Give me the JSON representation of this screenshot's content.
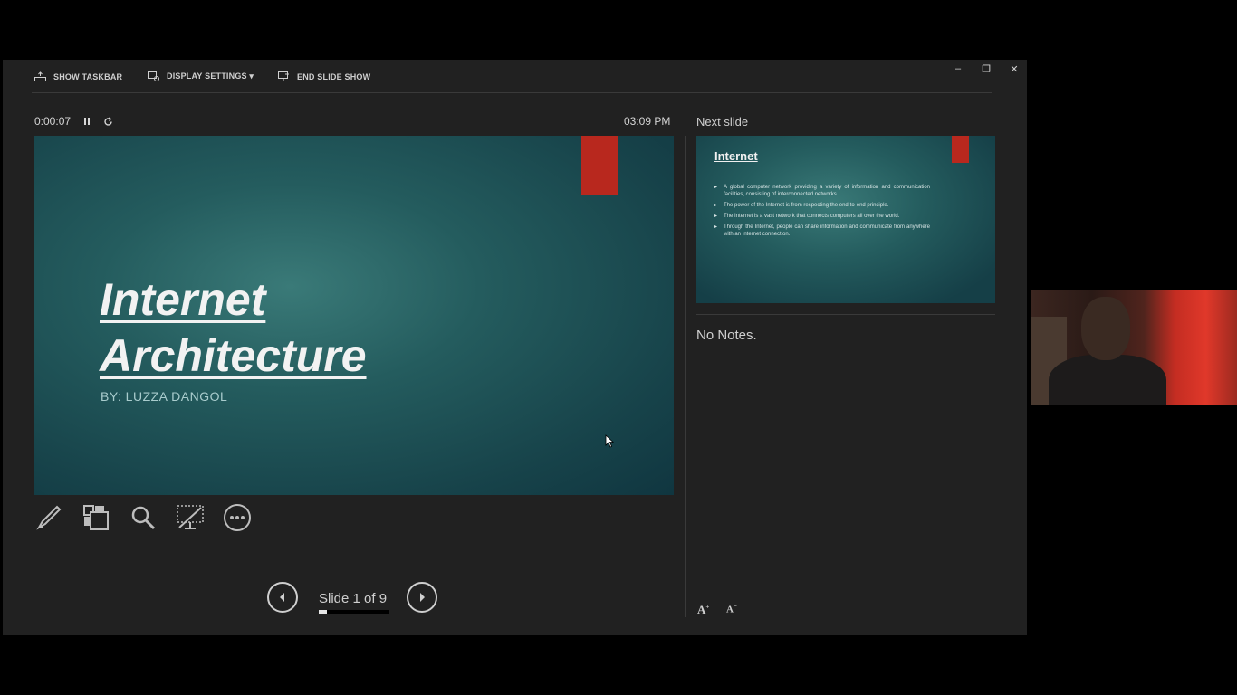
{
  "toolbar": {
    "show_taskbar": "SHOW TASKBAR",
    "display_settings": "DISPLAY SETTINGS ▾",
    "end_slide_show": "END SLIDE SHOW"
  },
  "window_controls": {
    "minimize": "–",
    "restore": "❐",
    "close": "✕"
  },
  "timer": {
    "elapsed": "0:00:07",
    "clock": "03:09 PM"
  },
  "current_slide": {
    "title_line1": "Internet",
    "title_line2": "Architecture",
    "subtitle": "BY: LUZZA DANGOL"
  },
  "tools": [
    "pen-icon",
    "slides-grid-icon",
    "zoom-icon",
    "black-screen-icon",
    "more-options-icon"
  ],
  "navigation": {
    "slide_counter": "Slide 1 of 9",
    "progress_fraction": 0.11
  },
  "next_slide": {
    "label": "Next slide",
    "title": "Internet",
    "bullets": [
      "A global computer network providing a variety of information and communication facilities, consisting of interconnected networks.",
      "The power of the Internet is from respecting the end-to-end principle.",
      "The Internet is a vast network that connects computers all over the world.",
      "Through the Internet, people can share information and communicate from anywhere with an Internet connection."
    ]
  },
  "notes": {
    "text": "No Notes."
  },
  "font_controls": {
    "increase": "A",
    "decrease": "A"
  },
  "colors": {
    "accent_red": "#b8281e",
    "background": "#212121",
    "slide_teal": "#245c5e"
  }
}
